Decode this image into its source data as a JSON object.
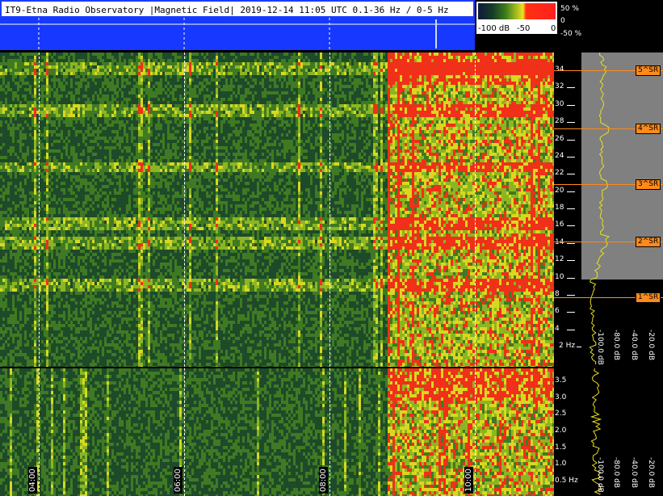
{
  "header": {
    "title": "IT9-Etna Radio Observatory |Magnetic Field| 2019-12-14 11:05 UTC 0.1-36 Hz / 0-5 Hz"
  },
  "colorbar": {
    "labels": [
      "-100 dB",
      "-50",
      "0"
    ],
    "percent_labels": [
      "50 %",
      "0",
      "-50 %"
    ]
  },
  "freq_axis_top": {
    "ticks": [
      "34",
      "32",
      "30",
      "28",
      "26",
      "24",
      "22",
      "20",
      "18",
      "16",
      "14",
      "12",
      "10",
      "8",
      "6",
      "4",
      "2 Hz"
    ]
  },
  "freq_axis_bottom": {
    "ticks": [
      "3.5",
      "3.0",
      "2.5",
      "2.0",
      "1.5",
      "1.0",
      "0.5 Hz"
    ]
  },
  "schumann": {
    "labels": [
      "5^SR",
      "4^SR",
      "3^SR",
      "2^SR",
      "1^SR"
    ]
  },
  "profile_scale": {
    "labels": [
      "-100.0 dB",
      "-80.0 dB",
      "-40.0 dB",
      "-20.0 dB"
    ]
  },
  "profile_scale_bottom": {
    "labels": [
      "-100.0 dB",
      "-80.0 dB",
      "-40.0 dB",
      "-20.0 dB"
    ]
  },
  "time_axis": {
    "labels": [
      "04:00",
      "06:00",
      "08:00",
      "10:00"
    ]
  },
  "colors": {
    "background": "#000000",
    "level_strip": "#1638ff",
    "schumann_marker": "#ff8a1a",
    "profile_trace": "#e8e020",
    "spectrogram_low": "#12402a",
    "spectrogram_mid": "#7ab020",
    "spectrogram_high": "#ff2020"
  }
}
